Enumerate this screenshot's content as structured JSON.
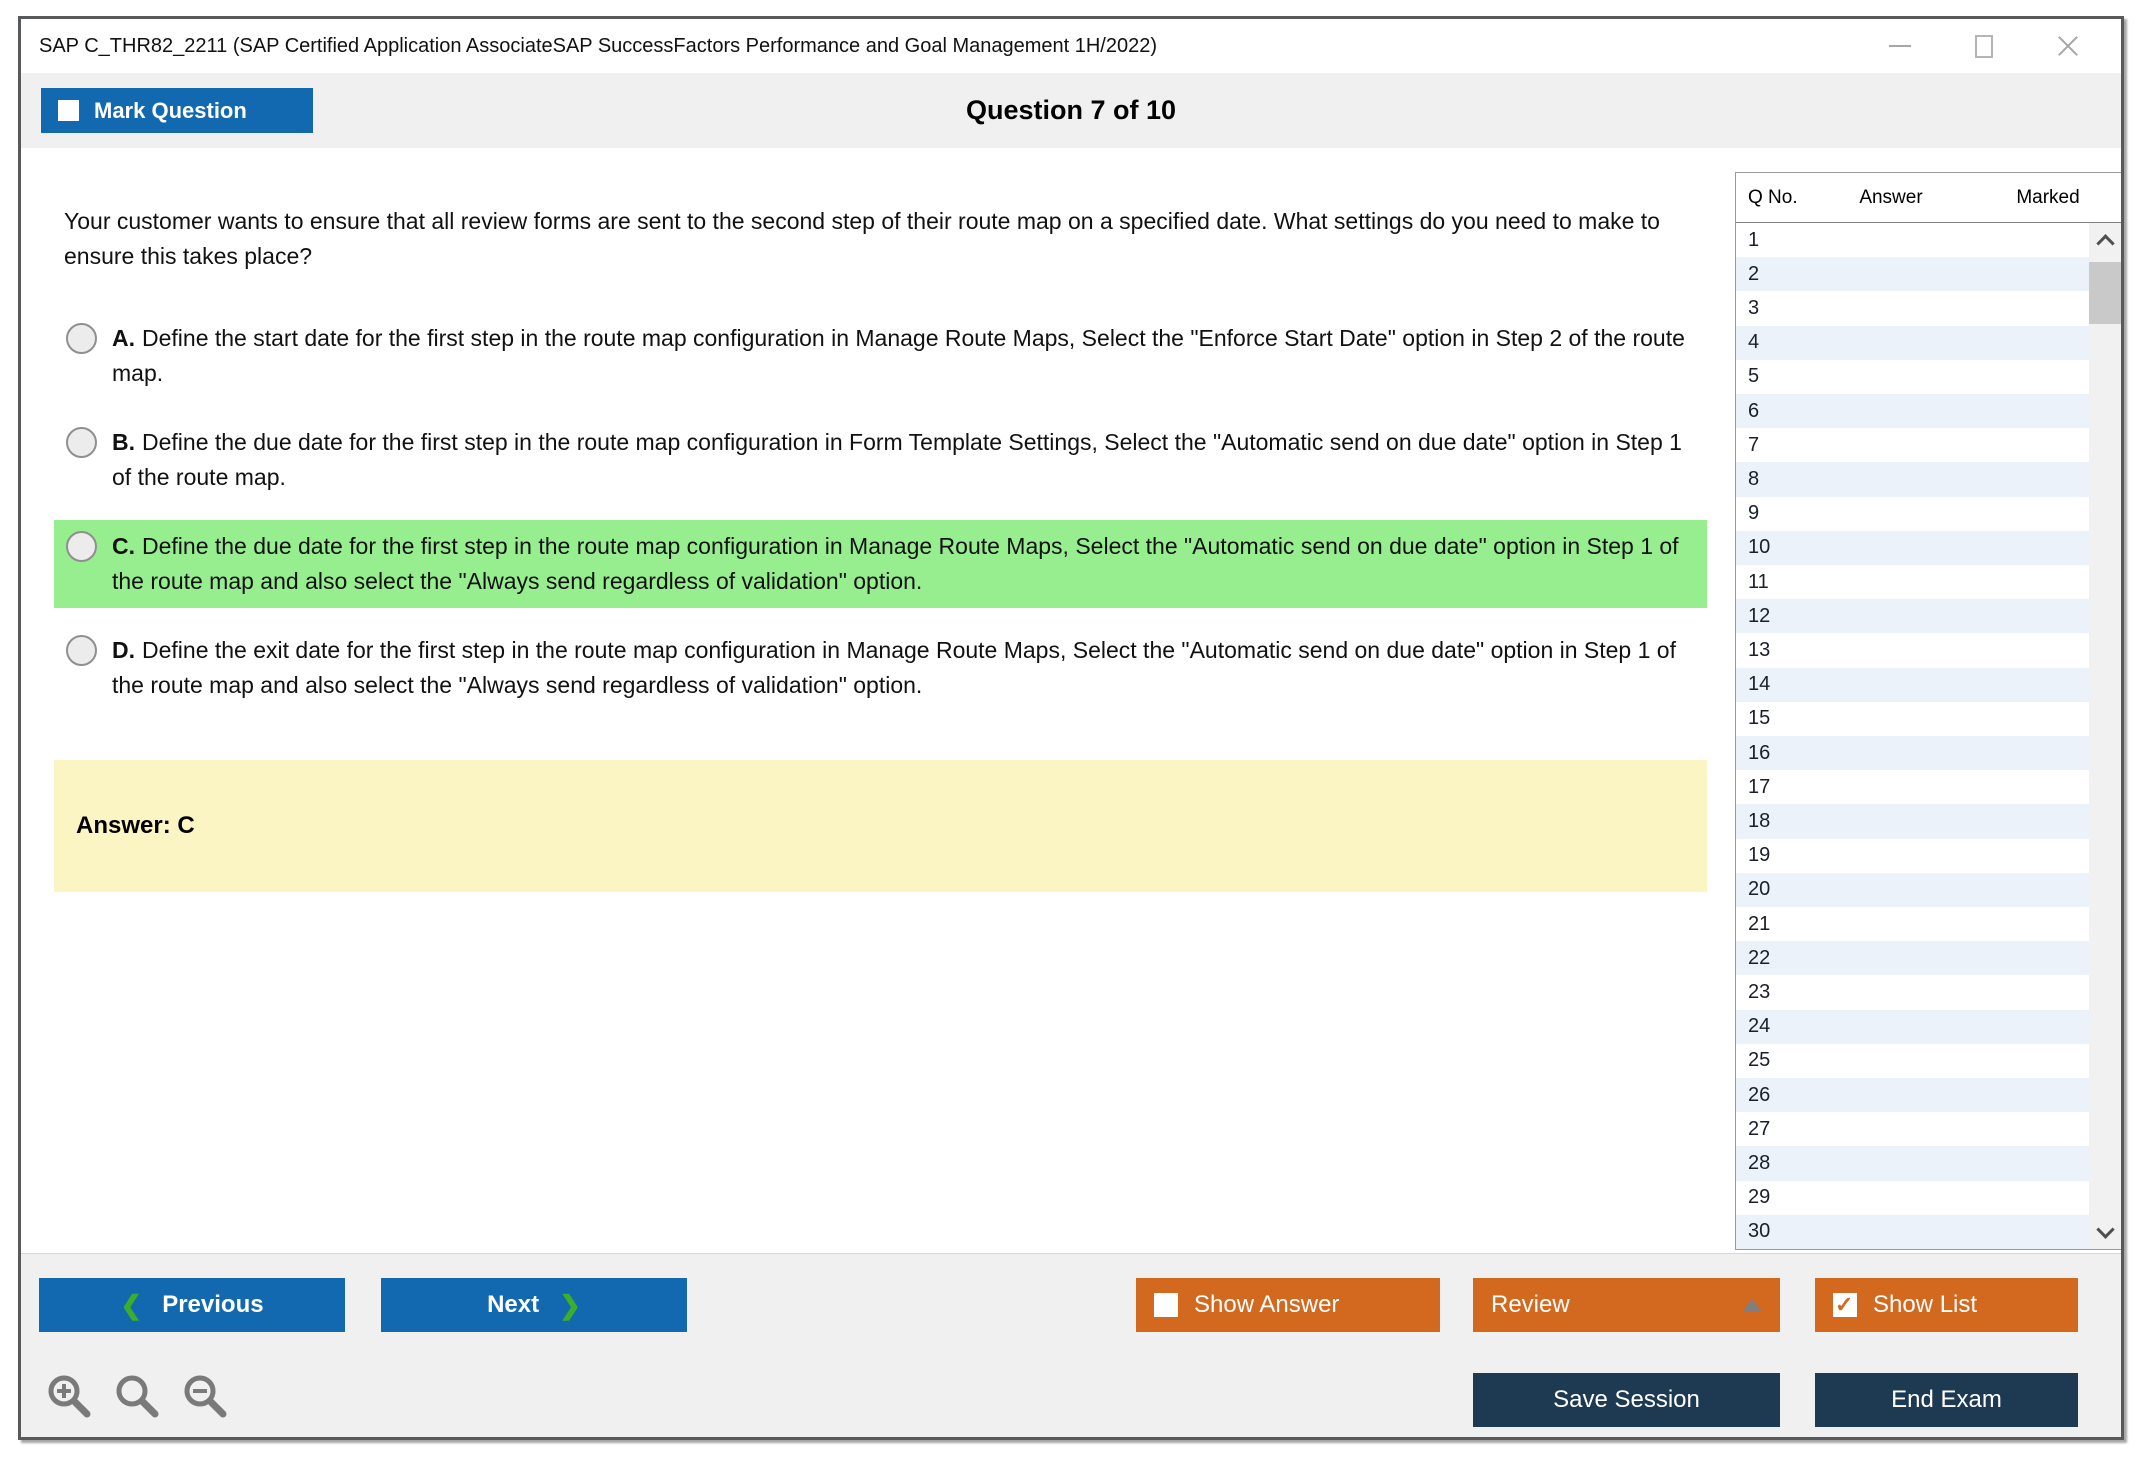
{
  "window": {
    "title": "SAP C_THR82_2211 (SAP Certified Application AssociateSAP SuccessFactors Performance and Goal Management 1H/2022)"
  },
  "header": {
    "mark_question_label": "Mark Question",
    "question_counter": "Question 7 of 10"
  },
  "question": {
    "text": "Your customer wants to ensure that all review forms are sent to the second step of their route map on a specified date. What settings do you need to make to ensure this takes place?"
  },
  "options": [
    {
      "letter": "A.",
      "text": "Define the start date for the first step in the route map configuration in Manage Route Maps, Select the \"Enforce Start Date\" option in Step 2 of the route map.",
      "highlighted": false
    },
    {
      "letter": "B.",
      "text": "Define the due date for the first step in the route map configuration in Form Template Settings, Select the \"Automatic send on due date\" option in Step 1 of the route map.",
      "highlighted": false
    },
    {
      "letter": "C.",
      "text": "Define the due date for the first step in the route map configuration in Manage Route Maps, Select the \"Automatic send on due date\" option in Step 1 of the route map and also select the \"Always send regardless of validation\" option.",
      "highlighted": true
    },
    {
      "letter": "D.",
      "text": "Define the exit date for the first step in the route map configuration in Manage Route Maps, Select the \"Automatic send on due date\" option in Step 1 of the route map and also select the \"Always send regardless of validation\" option.",
      "highlighted": false
    }
  ],
  "answer": {
    "label": "Answer: C"
  },
  "question_list": {
    "columns": [
      "Q No.",
      "Answer",
      "Marked"
    ],
    "visible_rows": [
      1,
      2,
      3,
      4,
      5,
      6,
      7,
      8,
      9,
      10,
      11,
      12,
      13,
      14,
      15,
      16,
      17,
      18,
      19,
      20,
      21,
      22,
      23,
      24,
      25,
      26,
      27,
      28,
      29,
      30
    ]
  },
  "footer": {
    "previous_label": "Previous",
    "next_label": "Next",
    "show_answer_label": "Show Answer",
    "review_label": "Review",
    "show_list_label": "Show List",
    "save_session_label": "Save Session",
    "end_exam_label": "End Exam",
    "show_answer_checked": false,
    "show_list_checked": true
  },
  "icons": {
    "window": [
      "minimize-icon",
      "maximize-icon",
      "close-icon"
    ],
    "buttons": [
      "checkbox-icon",
      "chevron-left-icon",
      "chevron-right-icon",
      "triangle-up-icon"
    ],
    "zoom": [
      "zoom-in-icon",
      "zoom-reset-icon",
      "zoom-out-icon"
    ],
    "scrollbar": [
      "chevron-up-icon",
      "chevron-down-icon"
    ]
  },
  "colors": {
    "blue": "#1269B0",
    "orange": "#D2691E",
    "navy": "#1E3A52",
    "highlight_green": "#97EE8F",
    "answer_yellow": "#FBF5C3",
    "row_alt_blue": "#EBF2F9",
    "chevron_green": "#3DAE2B"
  }
}
